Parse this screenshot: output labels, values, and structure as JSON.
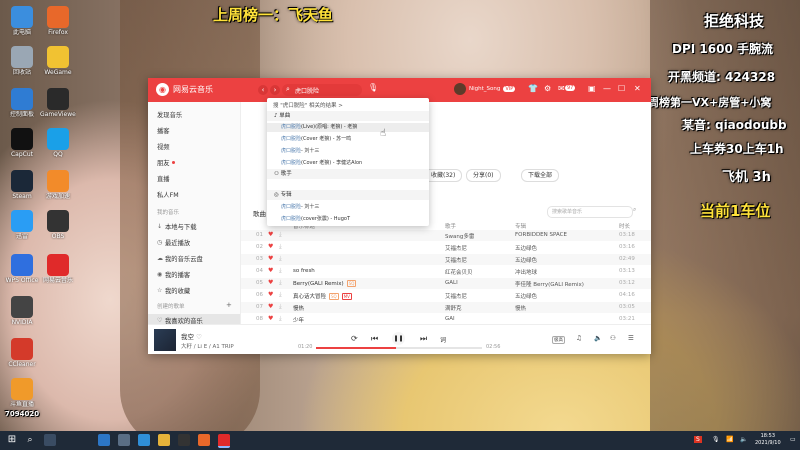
{
  "overlay": {
    "rank_banner": "上周榜一：飞天鱼",
    "right_lines": [
      "拒绝科技",
      "DPI 1600 手腕流",
      "开黑频道: 424328",
      "周榜第一VX+房管+小窝",
      "某音: qiaodoubb",
      "上车券30上车1h",
      "飞机 3h"
    ],
    "right_yellow": "当前1车位",
    "stream_id": "7094020"
  },
  "desktop_icons": [
    {
      "label": "此电脑",
      "color": "#3b8ede"
    },
    {
      "label": "Firefox",
      "color": "#e8682a"
    },
    {
      "label": "回收站",
      "color": "#9aa7b4"
    },
    {
      "label": "WeGame",
      "color": "#f1c232"
    },
    {
      "label": "控制面板",
      "color": "#2f7cd3"
    },
    {
      "label": "GameViewer",
      "color": "#2a2a2a"
    },
    {
      "label": "CapCut",
      "color": "#111111"
    },
    {
      "label": "QQ",
      "color": "#1aa0e8"
    },
    {
      "label": "Steam",
      "color": "#1b2838"
    },
    {
      "label": "游戏加速",
      "color": "#f28b2a"
    },
    {
      "label": "迅雷",
      "color": "#2a9df4"
    },
    {
      "label": "OBS",
      "color": "#333333"
    },
    {
      "label": "WPS Office",
      "color": "#2f6fdf"
    },
    {
      "label": "网易云音乐",
      "color": "#e02a2a"
    },
    {
      "label": "NVIDIA",
      "color": "#444444"
    },
    {
      "label": "CCleaner",
      "color": "#d43a2a"
    },
    {
      "label": "斗鱼直播",
      "color": "#f09a2a"
    }
  ],
  "app": {
    "logo": "网易云音乐",
    "search": {
      "value": "虎口脱险"
    },
    "user": {
      "name": "Night_Song",
      "vip": "VIP"
    },
    "notif_count": "97"
  },
  "sidebar": {
    "items": [
      {
        "label": "发现音乐",
        "icon": ""
      },
      {
        "label": "播客",
        "icon": ""
      },
      {
        "label": "视频",
        "icon": ""
      },
      {
        "label": "朋友",
        "icon": ""
      },
      {
        "label": "直播",
        "icon": ""
      },
      {
        "label": "私人FM",
        "icon": ""
      }
    ],
    "section_my": "我的音乐",
    "my_items": [
      {
        "label": "本地与下载",
        "icon": "↓"
      },
      {
        "label": "最近播放",
        "icon": "◷"
      },
      {
        "label": "我的音乐云盘",
        "icon": "☁"
      },
      {
        "label": "我的播客",
        "icon": "◉"
      },
      {
        "label": "我的收藏",
        "icon": "☆"
      }
    ],
    "section_created": "创建的歌单",
    "liked": "我喜欢的音乐"
  },
  "main": {
    "buttons": {
      "collect": "收藏(32)",
      "share": "分享(0)",
      "download_all": "下载全部"
    },
    "tab": "歌曲",
    "filter_placeholder": "搜索歌单音乐",
    "columns": {
      "title": "音乐标题",
      "artist": "歌手",
      "album": "专辑",
      "duration": "时长"
    },
    "rows": [
      {
        "num": "01",
        "title": "",
        "artist": "Swang多雷",
        "album": "FORBIDDEN SPACE",
        "duration": "03:18",
        "tags": []
      },
      {
        "num": "02",
        "title": "",
        "artist": "艾福杰尼",
        "album": "五边绿色",
        "duration": "03:16",
        "tags": []
      },
      {
        "num": "03",
        "title": "",
        "artist": "艾福杰尼",
        "album": "五边绿色",
        "duration": "02:49",
        "tags": []
      },
      {
        "num": "04",
        "title": "so fresh",
        "artist": "红花会贝贝",
        "album": "冲出地球",
        "duration": "03:13",
        "tags": []
      },
      {
        "num": "05",
        "title": "Berry(GALI Remix)",
        "artist": "GALI",
        "album": "李佳隆 Berry(GALI Remix)",
        "duration": "03:12",
        "tags": [
          "SQ"
        ]
      },
      {
        "num": "06",
        "title": "真心话大冒险",
        "artist": "艾福杰尼",
        "album": "五边绿色",
        "duration": "04:16",
        "tags": [
          "SQ",
          "MV"
        ]
      },
      {
        "num": "07",
        "title": "慢热",
        "artist": "满舒克",
        "album": "慢热",
        "duration": "03:05",
        "tags": []
      },
      {
        "num": "08",
        "title": "少年",
        "artist": "GAI",
        "album": "",
        "duration": "03:21",
        "tags": []
      }
    ]
  },
  "dropdown": {
    "header": "搜 \"虎口脱险\" 相关的结果 >",
    "section_songs": "单曲",
    "songs": [
      {
        "prefix": "虎口脱险",
        "rest": "(Live)(原唱: 老狼) - 老狼"
      },
      {
        "prefix": "虎口脱险",
        "rest": "(Cover 老狼) - 苏一鸣"
      },
      {
        "prefix": "虎口脱险",
        "rest": "- 刘十三"
      },
      {
        "prefix": "虎口脱险",
        "rest": "(Cover 老狼) - 李健达Alon"
      }
    ],
    "section_artists": "歌手",
    "section_albums": "专辑",
    "albums": [
      {
        "prefix": "虎口脱险",
        "rest": "- 刘十三"
      },
      {
        "prefix": "虎口脱险",
        "rest": "(cover张震) - HugoT"
      }
    ]
  },
  "player": {
    "title": "我空",
    "artist": "大籽 / Li E / A1 TRIP",
    "elapsed": "01:20",
    "total": "02:56",
    "progress": 0.48
  },
  "taskbar": {
    "time": "18:53",
    "date": "2021/9/10"
  }
}
